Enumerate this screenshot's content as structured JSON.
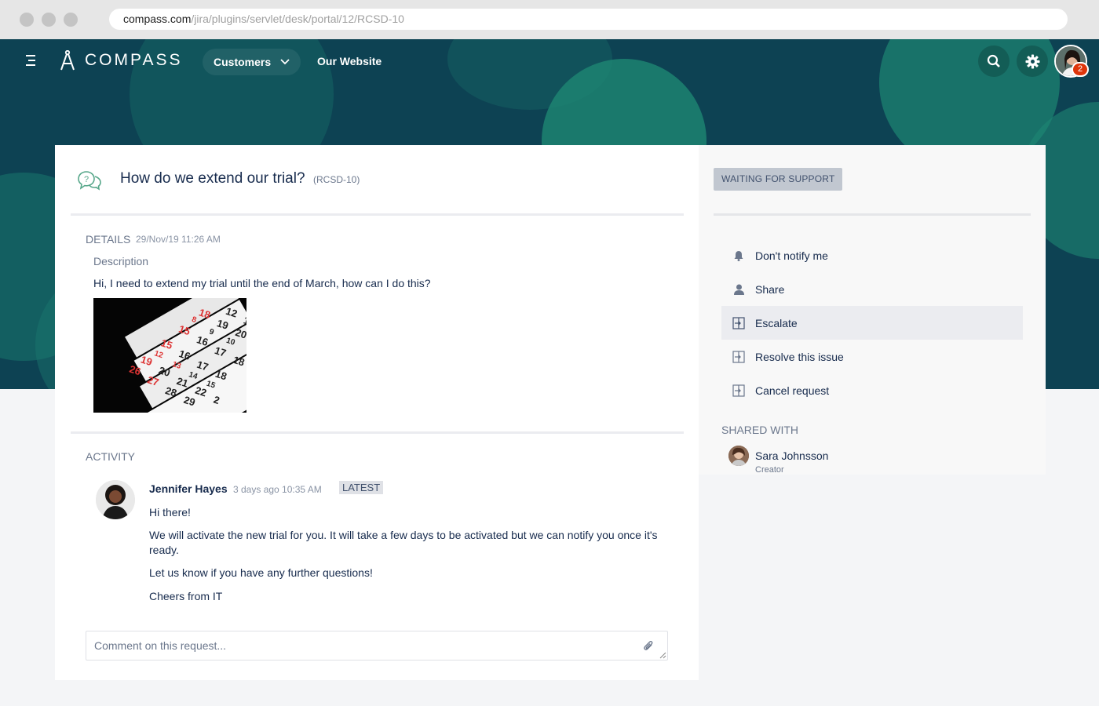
{
  "browser": {
    "url_domain": "compass.com",
    "url_path": "/jira/plugins/servlet/desk/portal/12/RCSD-10"
  },
  "nav": {
    "logo_text": "COMPASS",
    "customers_label": "Customers",
    "website_label": "Our Website",
    "notification_count": "2"
  },
  "request": {
    "title": "How do we extend our trial?",
    "key": "(RCSD-10)",
    "details_label": "DETAILS",
    "details_date": "29/Nov/19 11:26 AM",
    "description_label": "Description",
    "description_text": "Hi, I need to extend my trial until the end of March, how can I do this?",
    "calendar_numbers": [
      "12",
      "13",
      "18",
      "19",
      "20",
      "8",
      "9",
      "10",
      "15",
      "16",
      "17",
      "18",
      "15",
      "16",
      "17",
      "18",
      "12",
      "13",
      "14",
      "15",
      "19",
      "20",
      "21",
      "22",
      "26",
      "27",
      "28",
      "29",
      "2"
    ]
  },
  "activity": {
    "label": "ACTIVITY",
    "author": "Jennifer Hayes",
    "time": "3 days ago 10:35 AM",
    "latest_badge": "LATEST",
    "lines": [
      "Hi there!",
      "We will activate the new trial for you. It will take a few days to be activated but we can notify you once it's ready.",
      "Let us know if you have any further questions!",
      "Cheers from IT"
    ],
    "comment_placeholder": "Comment on this request..."
  },
  "sidebar": {
    "status": "WAITING FOR SUPPORT",
    "actions": [
      {
        "label": "Don't notify me",
        "icon": "bell-icon"
      },
      {
        "label": "Share",
        "icon": "person-icon"
      },
      {
        "label": "Escalate",
        "icon": "transition-icon"
      },
      {
        "label": "Resolve this issue",
        "icon": "transition-icon"
      },
      {
        "label": "Cancel request",
        "icon": "transition-icon"
      }
    ],
    "shared_with_label": "SHARED WITH",
    "shared_user": {
      "name": "Sara Johnsson",
      "role": "Creator"
    }
  },
  "colors": {
    "hero_bg": "#0d4253",
    "hero_accent": "#1a786e",
    "badge_red": "#de350b"
  }
}
